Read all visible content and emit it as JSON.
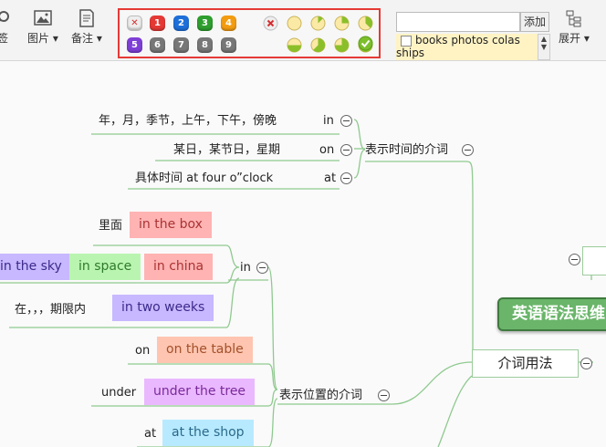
{
  "toolbar": {
    "image_label": "图片",
    "note_label": "备注",
    "partial_label": "签",
    "expand_label": "展开",
    "add_label": "添加",
    "tag_item": "books photos colas ships",
    "priorities": [
      "1",
      "2",
      "3",
      "4",
      "5",
      "6",
      "7",
      "8",
      "9"
    ],
    "priority_colors": [
      "#e53935",
      "#1e6fd9",
      "#2e9e2e",
      "#f39c12",
      "#7e3fd6",
      "#777777",
      "#777777",
      "#777777",
      "#777777"
    ]
  },
  "mindmap": {
    "center": "英语语法思维",
    "branch": "介词用法",
    "time_group": "表示时间的介词",
    "place_group": "表示位置的介词",
    "time_rows": [
      {
        "desc": "年，月，季节，上午，下午，傍晚",
        "prep": "in"
      },
      {
        "desc": "某日，某节日，星期",
        "prep": "on"
      },
      {
        "desc": "具体时间  at four o”clock",
        "prep": "at"
      }
    ],
    "in_node": "in",
    "in_desc": "里面",
    "in_chip": "in the box",
    "in_row2": [
      "in the sky",
      "in space",
      "in china"
    ],
    "in_period_desc": "在，，，期限内",
    "in_period_chip": "in two weeks",
    "on_word": "on",
    "on_chip": "on the table",
    "under_word": "under",
    "under_chip": "under the tree",
    "at_word": "at",
    "at_chip": "at the shop",
    "chip_colors": {
      "in_the_box": "#ffb3b3",
      "in_the_sky": "#c7b8ff",
      "in_space": "#b9f5b0",
      "in_china": "#ffb3b3",
      "in_two_weeks": "#c7b8ff",
      "on_the_table": "#ffc5b0",
      "under_the_tree": "#eab8ff",
      "at_the_shop": "#b8eaff"
    },
    "line_color": "#8fc98f"
  }
}
